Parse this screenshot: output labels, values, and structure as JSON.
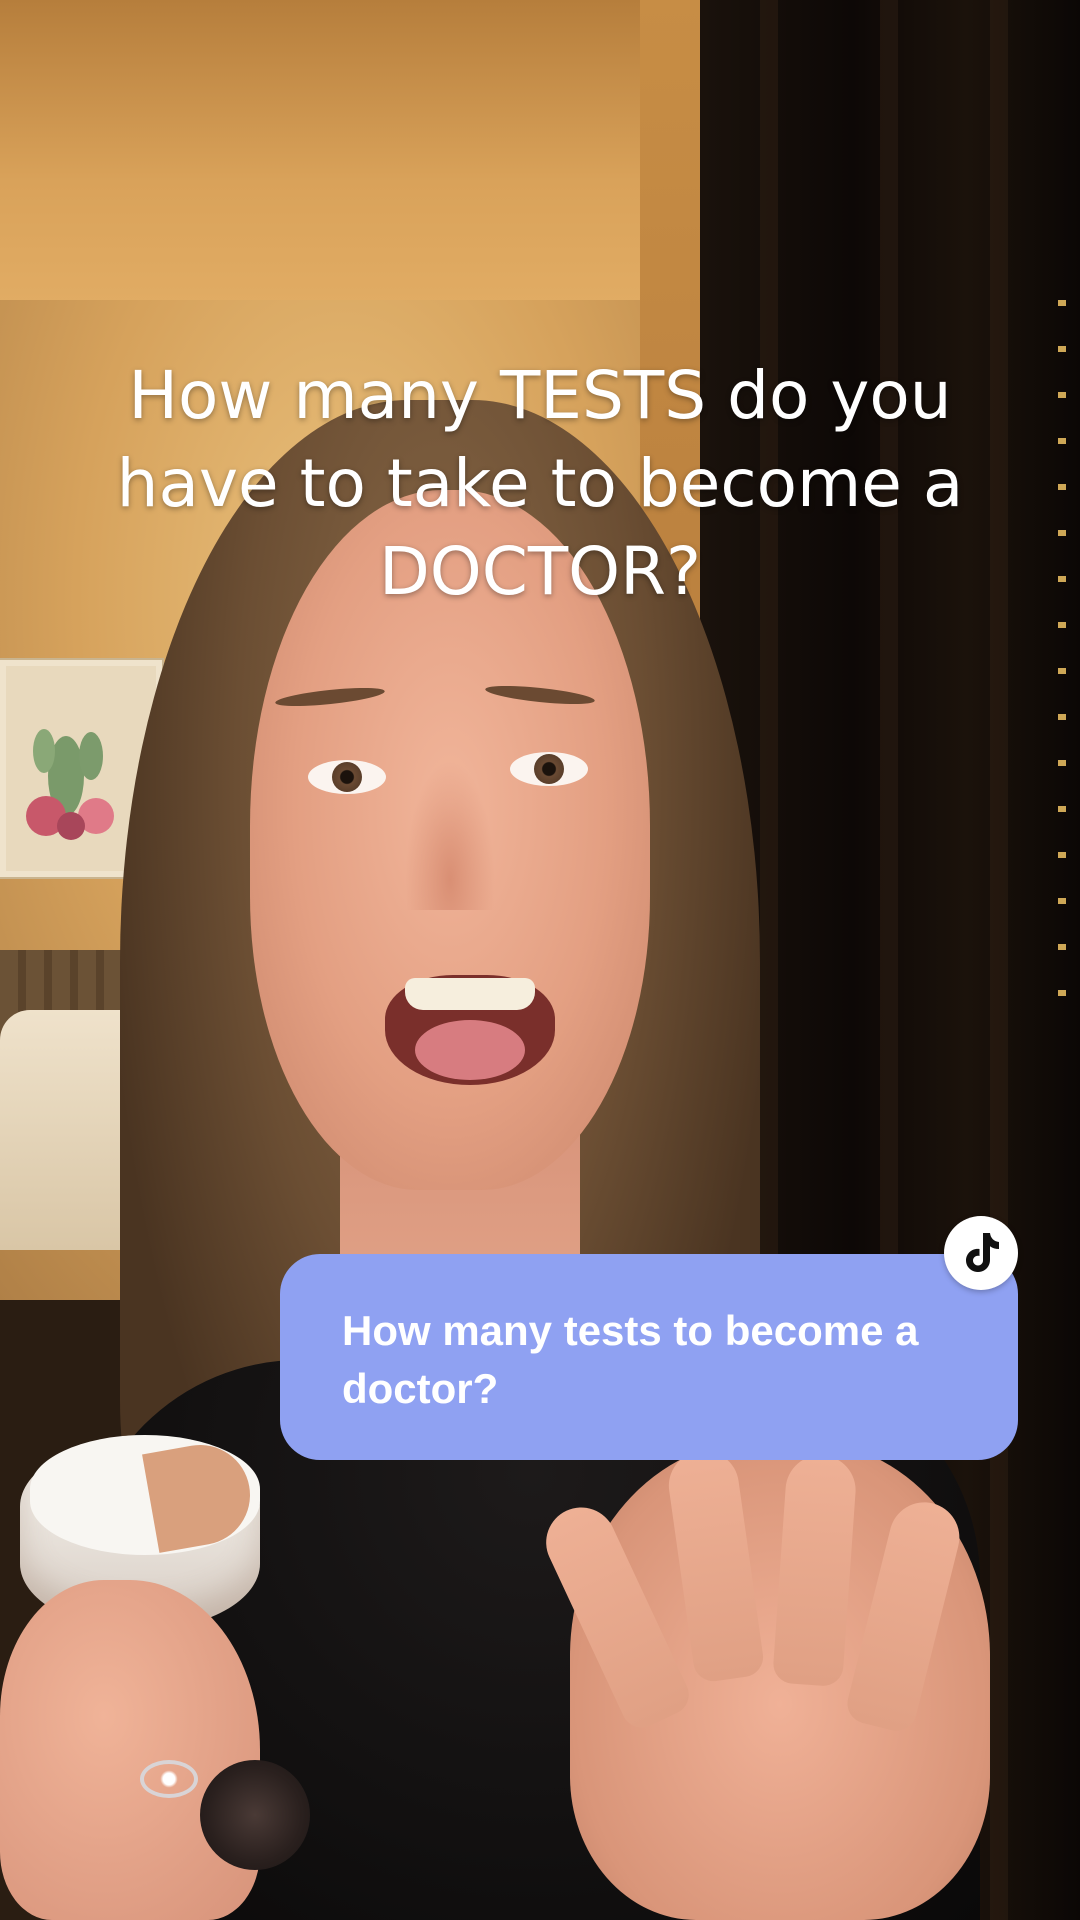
{
  "video": {
    "caption": "How many TESTS do you have to take to become a DOCTOR?"
  },
  "reply_card": {
    "text": "How many tests to become a doctor?",
    "background_color": "#8fa1f2",
    "badge_icon": "tiktok-logo-icon"
  }
}
